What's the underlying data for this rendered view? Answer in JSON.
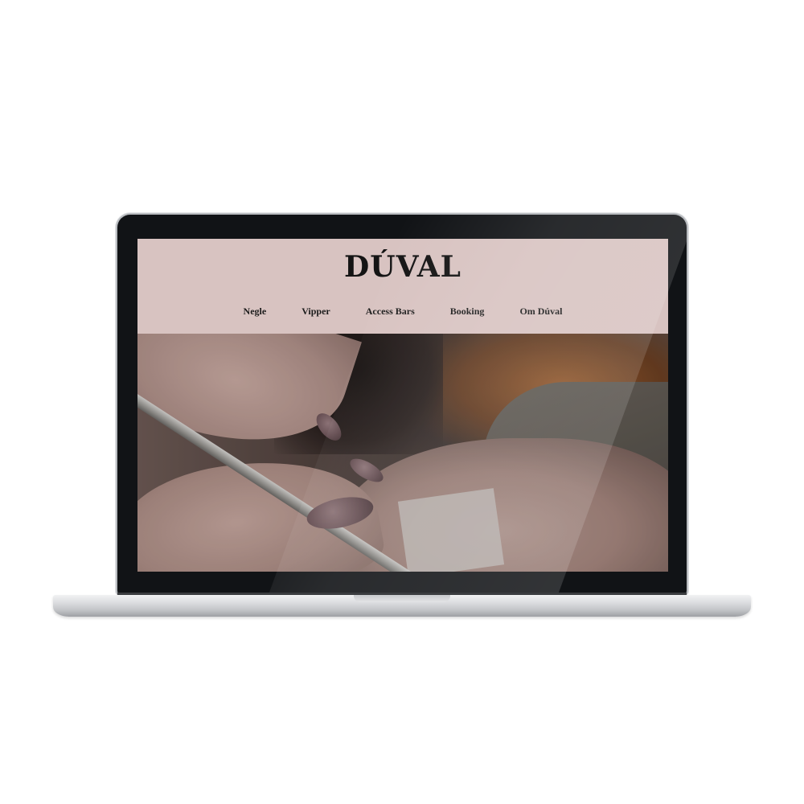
{
  "site": {
    "logo": "DÚVAL",
    "nav": [
      {
        "label": "Negle"
      },
      {
        "label": "Vipper"
      },
      {
        "label": "Access Bars"
      },
      {
        "label": "Booking"
      },
      {
        "label": "Om Dúval"
      }
    ],
    "header_color": "#d8c3c1"
  },
  "hero": {
    "image": "eyelash-extension-photo"
  }
}
